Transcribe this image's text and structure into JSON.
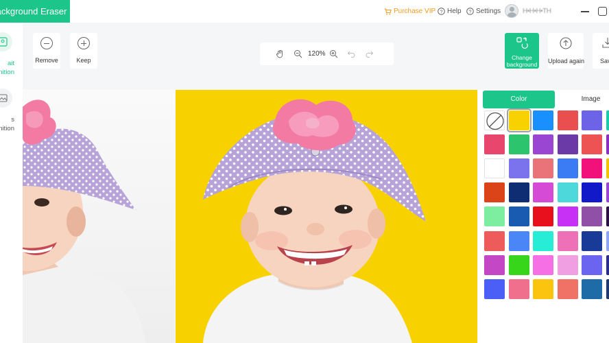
{
  "app": {
    "title": "Background Eraser"
  },
  "titlebar": {
    "purchase_vip": "Purchase VIP",
    "help": "Help",
    "settings": "Settings",
    "username": "H•H•H•TH"
  },
  "sidebar": {
    "items": [
      {
        "label_line1": "ait",
        "label_line2": "nition",
        "active": true
      },
      {
        "label_line1": "s",
        "label_line2": "nition",
        "active": false
      }
    ]
  },
  "toolbar": {
    "remove_label": "Remove",
    "keep_label": "Keep",
    "zoom_level": "120%",
    "change_background_line1": "Change",
    "change_background_line2": "background",
    "upload_again_label": "Upload again",
    "save_label": "Sav"
  },
  "panel": {
    "tabs": [
      {
        "label": "Color",
        "active": true
      },
      {
        "label": "Image",
        "active": false
      }
    ],
    "selected_color": "#f8d200",
    "swatches": [
      [
        "none",
        "#f8d200",
        "#1a8ffe",
        "#e94f4f",
        "#6c63e6",
        "#1ccca8"
      ],
      [
        "#e8466d",
        "#2cc46d",
        "#9b45d3",
        "#6b3aa6",
        "#ee5353",
        "#8a2fc0"
      ],
      [
        "#ffffff",
        "#7b73ee",
        "#e97378",
        "#3b7cf5",
        "#f2107a",
        "#f2c300"
      ],
      [
        "#db4419",
        "#0e2d73",
        "#d64bd6",
        "#4dd8dc",
        "#1219c8",
        "#9b45d3"
      ],
      [
        "#7ded9f",
        "#1a5bb2",
        "#e8101c",
        "#c730f5",
        "#9050a8",
        "#2a1046"
      ],
      [
        "#ee5b5b",
        "#4a86f6",
        "#27ecd6",
        "#ee70b7",
        "#173b96",
        "#8fa5f2"
      ],
      [
        "#c448c6",
        "#38d61a",
        "#f76fe5",
        "#f0a0e2",
        "#6a64f0",
        "#2c2c8c"
      ],
      [
        "#4b5ef5",
        "#f06f8c",
        "#fbc40f",
        "#f07266",
        "#1e6ba8",
        "#1f3b6e"
      ]
    ]
  }
}
